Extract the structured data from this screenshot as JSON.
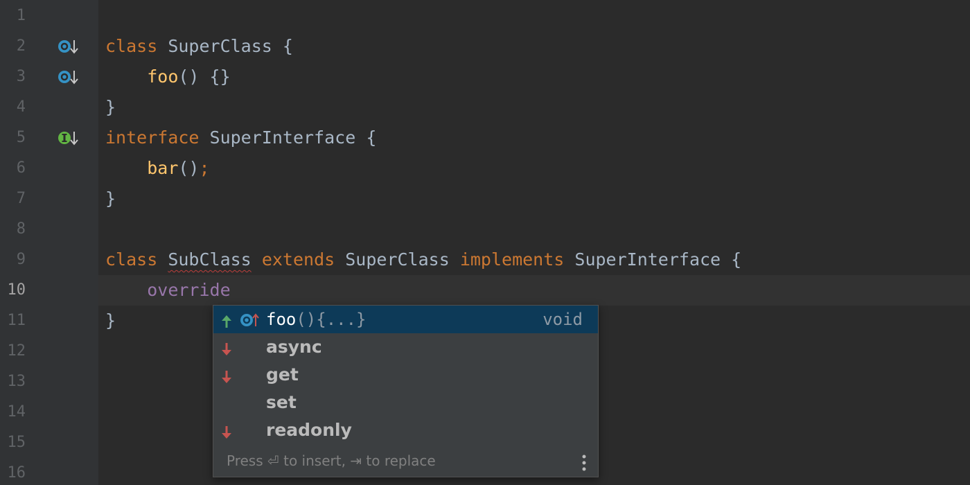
{
  "gutter": {
    "line_numbers": [
      "1",
      "2",
      "3",
      "4",
      "5",
      "6",
      "7",
      "8",
      "9",
      "10",
      "11",
      "12",
      "13",
      "14",
      "15",
      "16"
    ],
    "current_line": "10",
    "icons": [
      {
        "line": "2",
        "name": "class-overridden-icon"
      },
      {
        "line": "3",
        "name": "method-overridden-icon"
      },
      {
        "line": "5",
        "name": "interface-implemented-icon"
      }
    ]
  },
  "code": {
    "line2": {
      "kw": "class",
      "name": "SuperClass",
      "brace": "{"
    },
    "line3": {
      "fn": "foo",
      "rest": "() {}"
    },
    "line4": {
      "brace": "}"
    },
    "line5": {
      "kw": "interface",
      "name": "SuperInterface",
      "brace": "{"
    },
    "line6": {
      "fn": "bar",
      "parens": "()",
      "semi": ";"
    },
    "line7": {
      "brace": "}"
    },
    "line9": {
      "kw1": "class",
      "name": "SubClass",
      "kw2": "extends",
      "parent": "SuperClass",
      "kw3": "implements",
      "iface": "SuperInterface",
      "brace": "{"
    },
    "line10": {
      "typed": "override"
    },
    "line11": {
      "brace": "}"
    }
  },
  "completion": {
    "items": [
      {
        "label": "foo",
        "tail": "(){...}",
        "type": "void",
        "arrow": "up",
        "icon": "method-icon",
        "selected": true
      },
      {
        "label": "async",
        "arrow": "down"
      },
      {
        "label": "get",
        "arrow": "down"
      },
      {
        "label": "set",
        "arrow": "none"
      },
      {
        "label": "readonly",
        "arrow": "down"
      }
    ],
    "footer_hint": "Press ⏎ to insert, ⇥ to replace"
  },
  "colors": {
    "background": "#2b2b2b",
    "gutter": "#313335",
    "keyword": "#cc7832",
    "function": "#ffc66d",
    "identifier": "#a9b7c6",
    "typed_keyword": "#9876aa",
    "popup_bg": "#3c3f41",
    "popup_selected": "#0d3a58",
    "arrow_up": "#59a869",
    "arrow_down": "#c75450",
    "method_icon": "#3592c4",
    "interface_icon": "#62b543"
  }
}
